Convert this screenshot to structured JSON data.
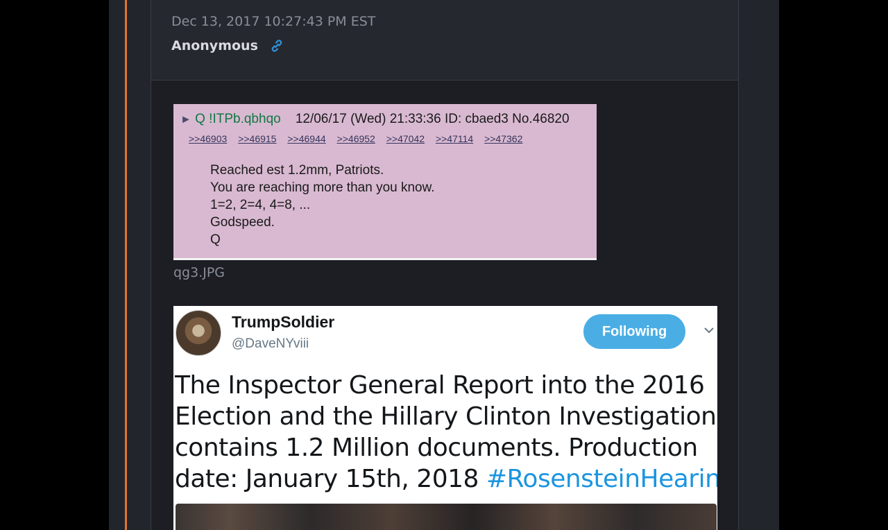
{
  "post": {
    "timestamp": "Dec 13, 2017 10:27:43 PM EST",
    "author": "Anonymous",
    "link_icon": "link-icon",
    "accent_color": "#e1762a"
  },
  "q_post": {
    "arrow": "►",
    "name": "Q !ITPb.qbhqo",
    "meta": "12/06/17 (Wed) 21:33:36 ID: cbaed3 No.46820",
    "replies": [
      ">>46903",
      ">>46915",
      ">>46944",
      ">>46952",
      ">>47042",
      ">>47114",
      ">>47362"
    ],
    "lines": [
      "Reached est 1.2mm, Patriots.",
      "You are reaching more than you know.",
      "1=2, 2=4, 4=8, ...",
      "Godspeed.",
      "Q"
    ],
    "caption": "qg3.JPG"
  },
  "tweet": {
    "name": "TrumpSoldier",
    "handle": "@DaveNYviii",
    "follow_label": "Following",
    "text_lines": [
      "The Inspector General Report into the 2016",
      "Election and the Hillary Clinton Investigation",
      "contains 1.2 Million documents.  Production",
      "date: January 15th, 2018 "
    ],
    "hashtag": "#RosensteinHearing",
    "follow_color": "#4aaee5",
    "hashtag_color": "#1b95e0"
  }
}
